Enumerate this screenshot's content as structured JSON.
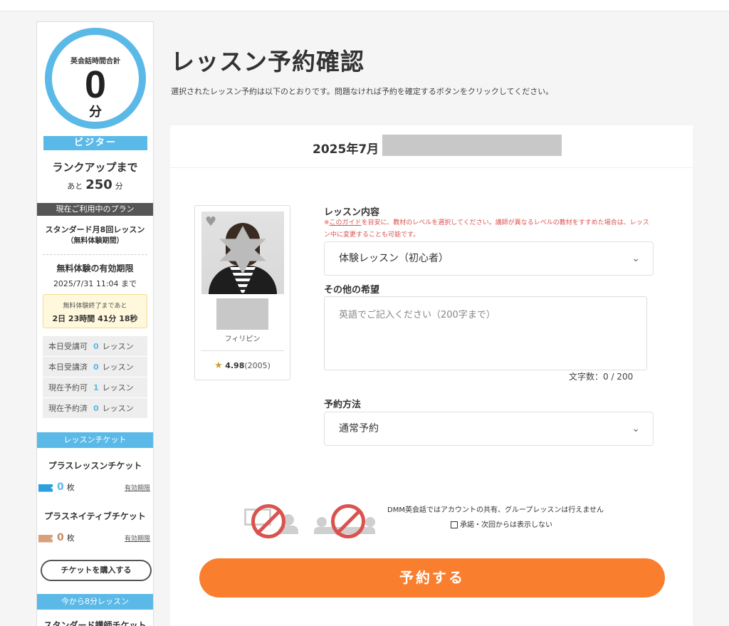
{
  "sidebar": {
    "ring_label": "英会話時間合計",
    "ring_value": "0",
    "ring_unit": "分",
    "rank": "ビジター",
    "rankup_title": "ランクアップまで",
    "remain_prefix": "あと",
    "remain_value": "250",
    "remain_unit": "分",
    "plan_header": "現在ご利用中のプラン",
    "plan_name_line1": "スタンダード月8回レッスン",
    "plan_name_line2": "（無料体験期間）",
    "trial_title": "無料体験の有効期限",
    "trial_date": "2025/7/31 11:04 まで",
    "trial_box_line1": "無料体験終了まであと",
    "trial_box_line2": "2日 23時間 41分 18秒",
    "stats": [
      {
        "label": "本日受講可",
        "value": "0",
        "unit": "レッスン"
      },
      {
        "label": "本日受講済",
        "value": "0",
        "unit": "レッスン"
      },
      {
        "label": "現在予約可",
        "value": "1",
        "unit": "レッスン"
      },
      {
        "label": "現在予約済",
        "value": "0",
        "unit": "レッスン"
      }
    ],
    "ticket_header": "レッスンチケット",
    "plus_ticket_title": "プラスレッスンチケット",
    "plus_ticket_count": "0",
    "plus_ticket_unit": "枚",
    "plus_ticket_expiry": "有効期限",
    "native_ticket_title": "プラスネイティブチケット",
    "native_ticket_count": "0",
    "native_ticket_unit": "枚",
    "native_ticket_expiry": "有効期限",
    "buy_button": "チケットを購入する",
    "now_header": "今から8分レッスン",
    "std_ticket_title": "スタンダード講師チケット"
  },
  "main": {
    "title": "レッスン予約確認",
    "description": "選択されたレッスン予約は以下のとおりです。問題なければ予約を確定するボタンをクリックしてください。",
    "date": "2025年7月",
    "tutor": {
      "country": "フィリピン",
      "rating": "4.98",
      "reviews": "(2005)"
    },
    "lesson_content_label": "レッスン内容",
    "guide_prefix": "※",
    "guide_link": "このガイド",
    "guide_text": "を目安に、教材のレベルを選択してください。講師が異なるレベルの教材をすすめた場合は、レッスン中に変更することも可能です。",
    "lesson_content_value": "体験レッスン（初心者）",
    "other_requests_label": "その他の希望",
    "other_requests_placeholder": "英語でご記入ください（200字まで）",
    "char_count": "文字数：0 / 200",
    "method_label": "予約方法",
    "method_value": "通常予約",
    "notice": "DMM英会話ではアカウントの共有、グループレッスンは行えません",
    "agree_label": "承諾・次回からは表示しない",
    "reserve_button": "予約する"
  },
  "colors": {
    "accent_blue": "#5bb9e8",
    "reserve_orange": "#f97f2f",
    "warning_red": "#d9534f"
  }
}
